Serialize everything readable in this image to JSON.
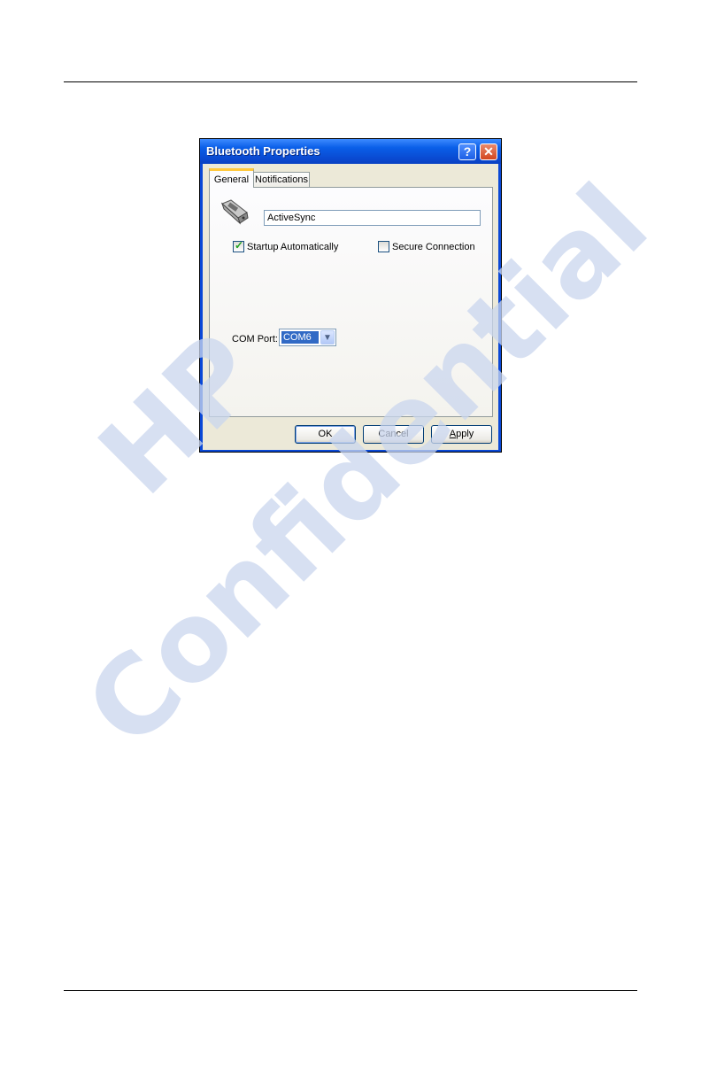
{
  "dialog": {
    "title": "Bluetooth Properties",
    "help_button": "?",
    "close_button": "✕",
    "tabs": [
      {
        "label": "General",
        "active": true
      },
      {
        "label": "Notifications",
        "active": false
      }
    ],
    "device_icon": "serial-connector-icon",
    "device_name": "ActiveSync",
    "startup": {
      "label": "Startup Automatically",
      "checked": true
    },
    "secure": {
      "label": "Secure Connection",
      "checked": false
    },
    "com_port": {
      "label": "COM Port:",
      "value": "COM6"
    },
    "buttons": {
      "ok": "OK",
      "cancel": "Cancel",
      "apply_underlined": "A",
      "apply_rest": "pply"
    }
  },
  "watermark": {
    "line1": "HP",
    "line2": "Confidential"
  },
  "colors": {
    "titlebar": "#0a5fe8",
    "face": "#ece9d8",
    "selection": "#316ac5",
    "check": "#21a121",
    "watermark": "#c9d6ee"
  }
}
